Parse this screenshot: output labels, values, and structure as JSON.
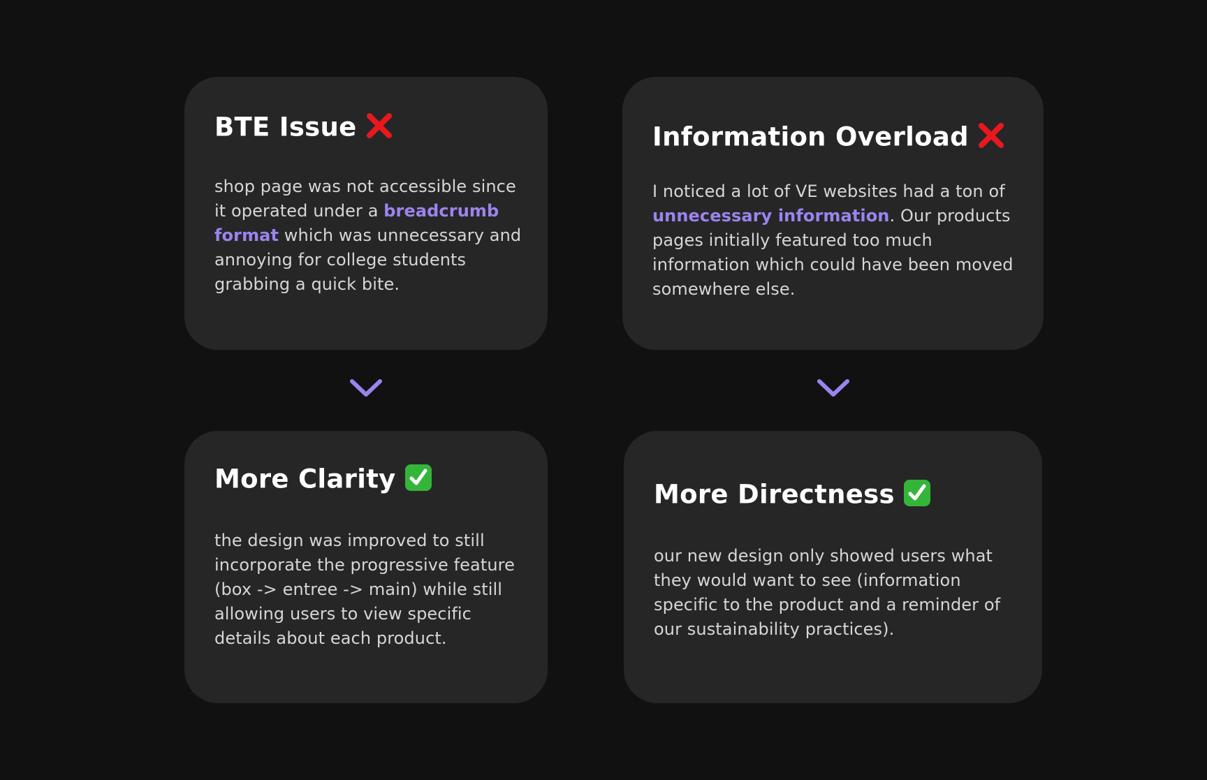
{
  "cards": {
    "bte_issue": {
      "title": "BTE Issue",
      "status_icon": "cross-mark-icon",
      "body_before": "shop page was not accessible since it operated under a ",
      "body_highlight": "breadcrumb format",
      "body_after": " which was unnecessary and annoying for college students grabbing a quick bite."
    },
    "info_overload": {
      "title": "Information Overload",
      "status_icon": "cross-mark-icon",
      "body_before": "I noticed a lot of VE websites had a ton of ",
      "body_highlight": "unnecessary information",
      "body_after": ". Our products pages initially featured too much information which could have been moved somewhere else."
    },
    "more_clarity": {
      "title": "More Clarity",
      "status_icon": "check-mark-icon",
      "body": "the design was improved to still incorporate the progressive feature (box -> entree -> main) while still allowing users to view specific details about each product."
    },
    "more_directness": {
      "title": "More Directness",
      "status_icon": "check-mark-icon",
      "body": "our new design only showed users what they would want to see (information specific to the product and a reminder of our sustainability practices)."
    }
  },
  "connectors": [
    "chevron-down-icon",
    "chevron-down-icon"
  ],
  "colors": {
    "background": "#111112",
    "card": "#262627",
    "accent": "#9b84ee",
    "error": "#e8181f",
    "success": "#34b53a"
  }
}
